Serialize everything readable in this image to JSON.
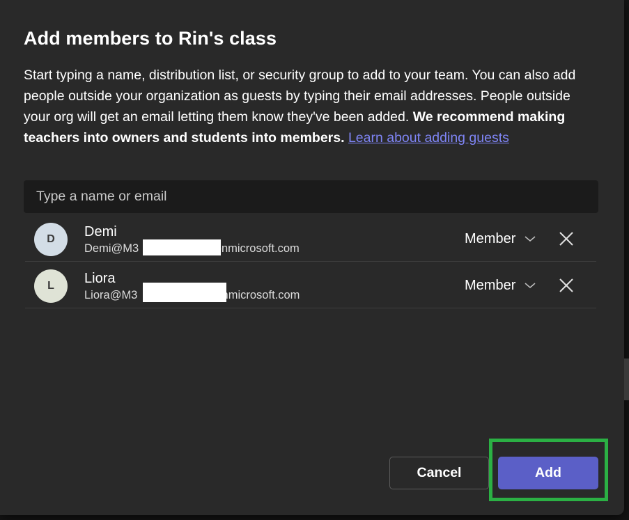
{
  "dialog": {
    "title": "Add members to Rin's class",
    "description": "Start typing a name, distribution list, or security group to add to your team. You can also add people outside your organization as guests by typing their email addresses. People outside your org will get an email letting them know they've been added. ",
    "description_bold": "We recommend making teachers into owners and students into members.",
    "learn_link": "Learn about adding guests"
  },
  "search": {
    "placeholder": "Type a name or email"
  },
  "members": [
    {
      "initial": "D",
      "name": "Demi",
      "email_start": "Demi@M3",
      "email_end": ".onmicrosoft.com",
      "role": "Member",
      "avatar_color": "#d3dde6"
    },
    {
      "initial": "L",
      "name": "Liora",
      "email_start": "Liora@M3",
      "email_end": "onmicrosoft.com",
      "role": "Member",
      "avatar_color": "#dfe3d6"
    }
  ],
  "footer": {
    "cancel_label": "Cancel",
    "add_label": "Add"
  },
  "colors": {
    "dialog_bg": "#292929",
    "accent": "#5b5fc7",
    "link": "#7f85f5",
    "highlight": "#2bb044"
  }
}
